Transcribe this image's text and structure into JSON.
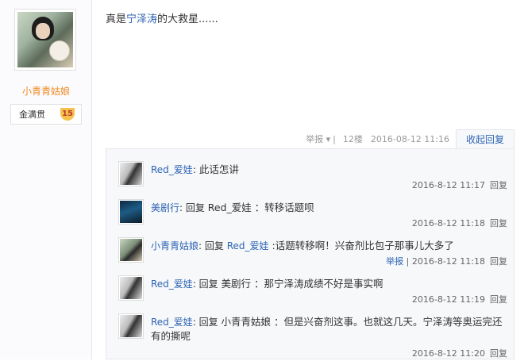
{
  "author": {
    "name": "小青青姑娘",
    "badge_label": "金满贯",
    "badge_level": "15"
  },
  "post": {
    "prefix": "真是",
    "link": "宁泽涛",
    "suffix": "的大救星......"
  },
  "meta": {
    "report": "举报",
    "report_arrow": "▾",
    "sep": "|",
    "floor": "12楼",
    "time": "2016-08-12 11:16",
    "collapse": "收起回复"
  },
  "replies": [
    {
      "user": "Red_爱娃",
      "colon": ":",
      "reply_prefix": "",
      "reply_to": "",
      "text": " 此话怎讲",
      "time": "2016-8-12 11:17",
      "reply_label": "回复",
      "report": ""
    },
    {
      "user": "美剧行",
      "colon": ":",
      "reply_prefix": " 回复 ",
      "reply_to": "Red_爱娃",
      "text": " ：转移话题呗",
      "time": "2016-8-12 11:18",
      "reply_label": "回复",
      "report": ""
    },
    {
      "user": "小青青姑娘",
      "colon": ":",
      "reply_prefix": " 回复 ",
      "reply_to": "Red_爱娃",
      "text": " :话题转移啊！兴奋剂比包子那事儿大多了",
      "time": "2016-8-12 11:18",
      "reply_label": "回复",
      "report": "举报"
    },
    {
      "user": "Red_爱娃",
      "colon": ":",
      "reply_prefix": " 回复 ",
      "reply_to": "美剧行",
      "text": " ：那宁泽涛成绩不好是事实啊",
      "time": "2016-8-12 11:19",
      "reply_label": "回复",
      "report": ""
    },
    {
      "user": "Red_爱娃",
      "colon": ":",
      "reply_prefix": " 回复 ",
      "reply_to": "小青青姑娘",
      "text": " ：但是兴奋剂这事。也就这几天。宁泽涛等奥运完还有的撕呢",
      "time": "2016-8-12 11:20",
      "reply_label": "回复",
      "report": ""
    }
  ]
}
